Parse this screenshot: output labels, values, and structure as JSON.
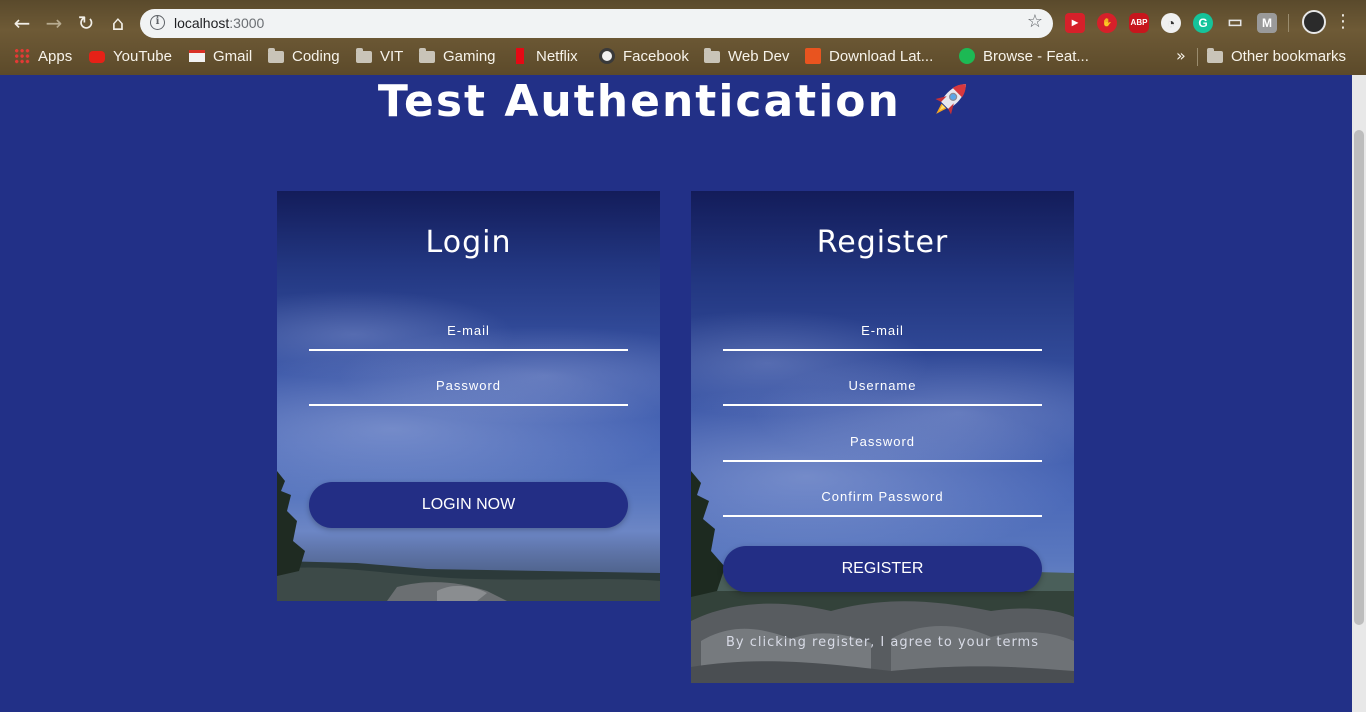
{
  "browser": {
    "nav": {
      "back": "←",
      "forward": "→",
      "reload": "↻",
      "home": "⌂"
    },
    "address": {
      "host": "localhost",
      "port": ":3000",
      "info_glyph": "i"
    },
    "bookmark_star": "☆",
    "extensions": [
      {
        "name": "screen-recorder-extension-icon",
        "label": "▶",
        "color": "#d6202a"
      },
      {
        "name": "adblock-stop-extension-icon",
        "label": "✋",
        "color": "#d6202a"
      },
      {
        "name": "abp-extension-icon",
        "label": "ABP",
        "color": "#c7161d"
      },
      {
        "name": "speed-dial-extension-icon",
        "label": "◔",
        "color": "#f0f0f0"
      },
      {
        "name": "grammarly-extension-icon",
        "label": "G",
        "color": "#15c39a"
      },
      {
        "name": "cast-extension-icon",
        "label": "▭",
        "color": "#cfcfcf"
      },
      {
        "name": "m-extension-icon",
        "label": "M",
        "color": "#9a9a9a"
      }
    ],
    "menu_glyph": "⋮",
    "bookmarks": [
      {
        "label": "Apps",
        "icon": "apps-grid-icon"
      },
      {
        "label": "YouTube",
        "icon": "youtube-icon"
      },
      {
        "label": "Gmail",
        "icon": "gmail-icon"
      },
      {
        "label": "Coding",
        "icon": "folder-icon"
      },
      {
        "label": "VIT",
        "icon": "folder-icon"
      },
      {
        "label": "Gaming",
        "icon": "folder-icon"
      },
      {
        "label": "Netflix",
        "icon": "netflix-icon"
      },
      {
        "label": "Facebook",
        "icon": "globe-icon"
      },
      {
        "label": "Web Dev",
        "icon": "folder-icon"
      },
      {
        "label": "Download Lat...",
        "icon": "g-icon"
      },
      {
        "label": "Browse - Feat...",
        "icon": "spotify-icon"
      }
    ],
    "more_bookmarks_glyph": "»",
    "other_bookmarks": "Other bookmarks"
  },
  "page": {
    "title": "Test Authentication",
    "title_emoji": "rocket",
    "login": {
      "title": "Login",
      "email_placeholder": "E-mail",
      "password_placeholder": "Password",
      "button": "LOGIN NOW"
    },
    "register": {
      "title": "Register",
      "email_placeholder": "E-mail",
      "username_placeholder": "Username",
      "password_placeholder": "Password",
      "confirm_placeholder": "Confirm Password",
      "button": "REGISTER",
      "terms": "By clicking register, I agree to your terms"
    }
  },
  "colors": {
    "page_background": "#223087",
    "button": "#232e85",
    "text": "#ffffff"
  }
}
